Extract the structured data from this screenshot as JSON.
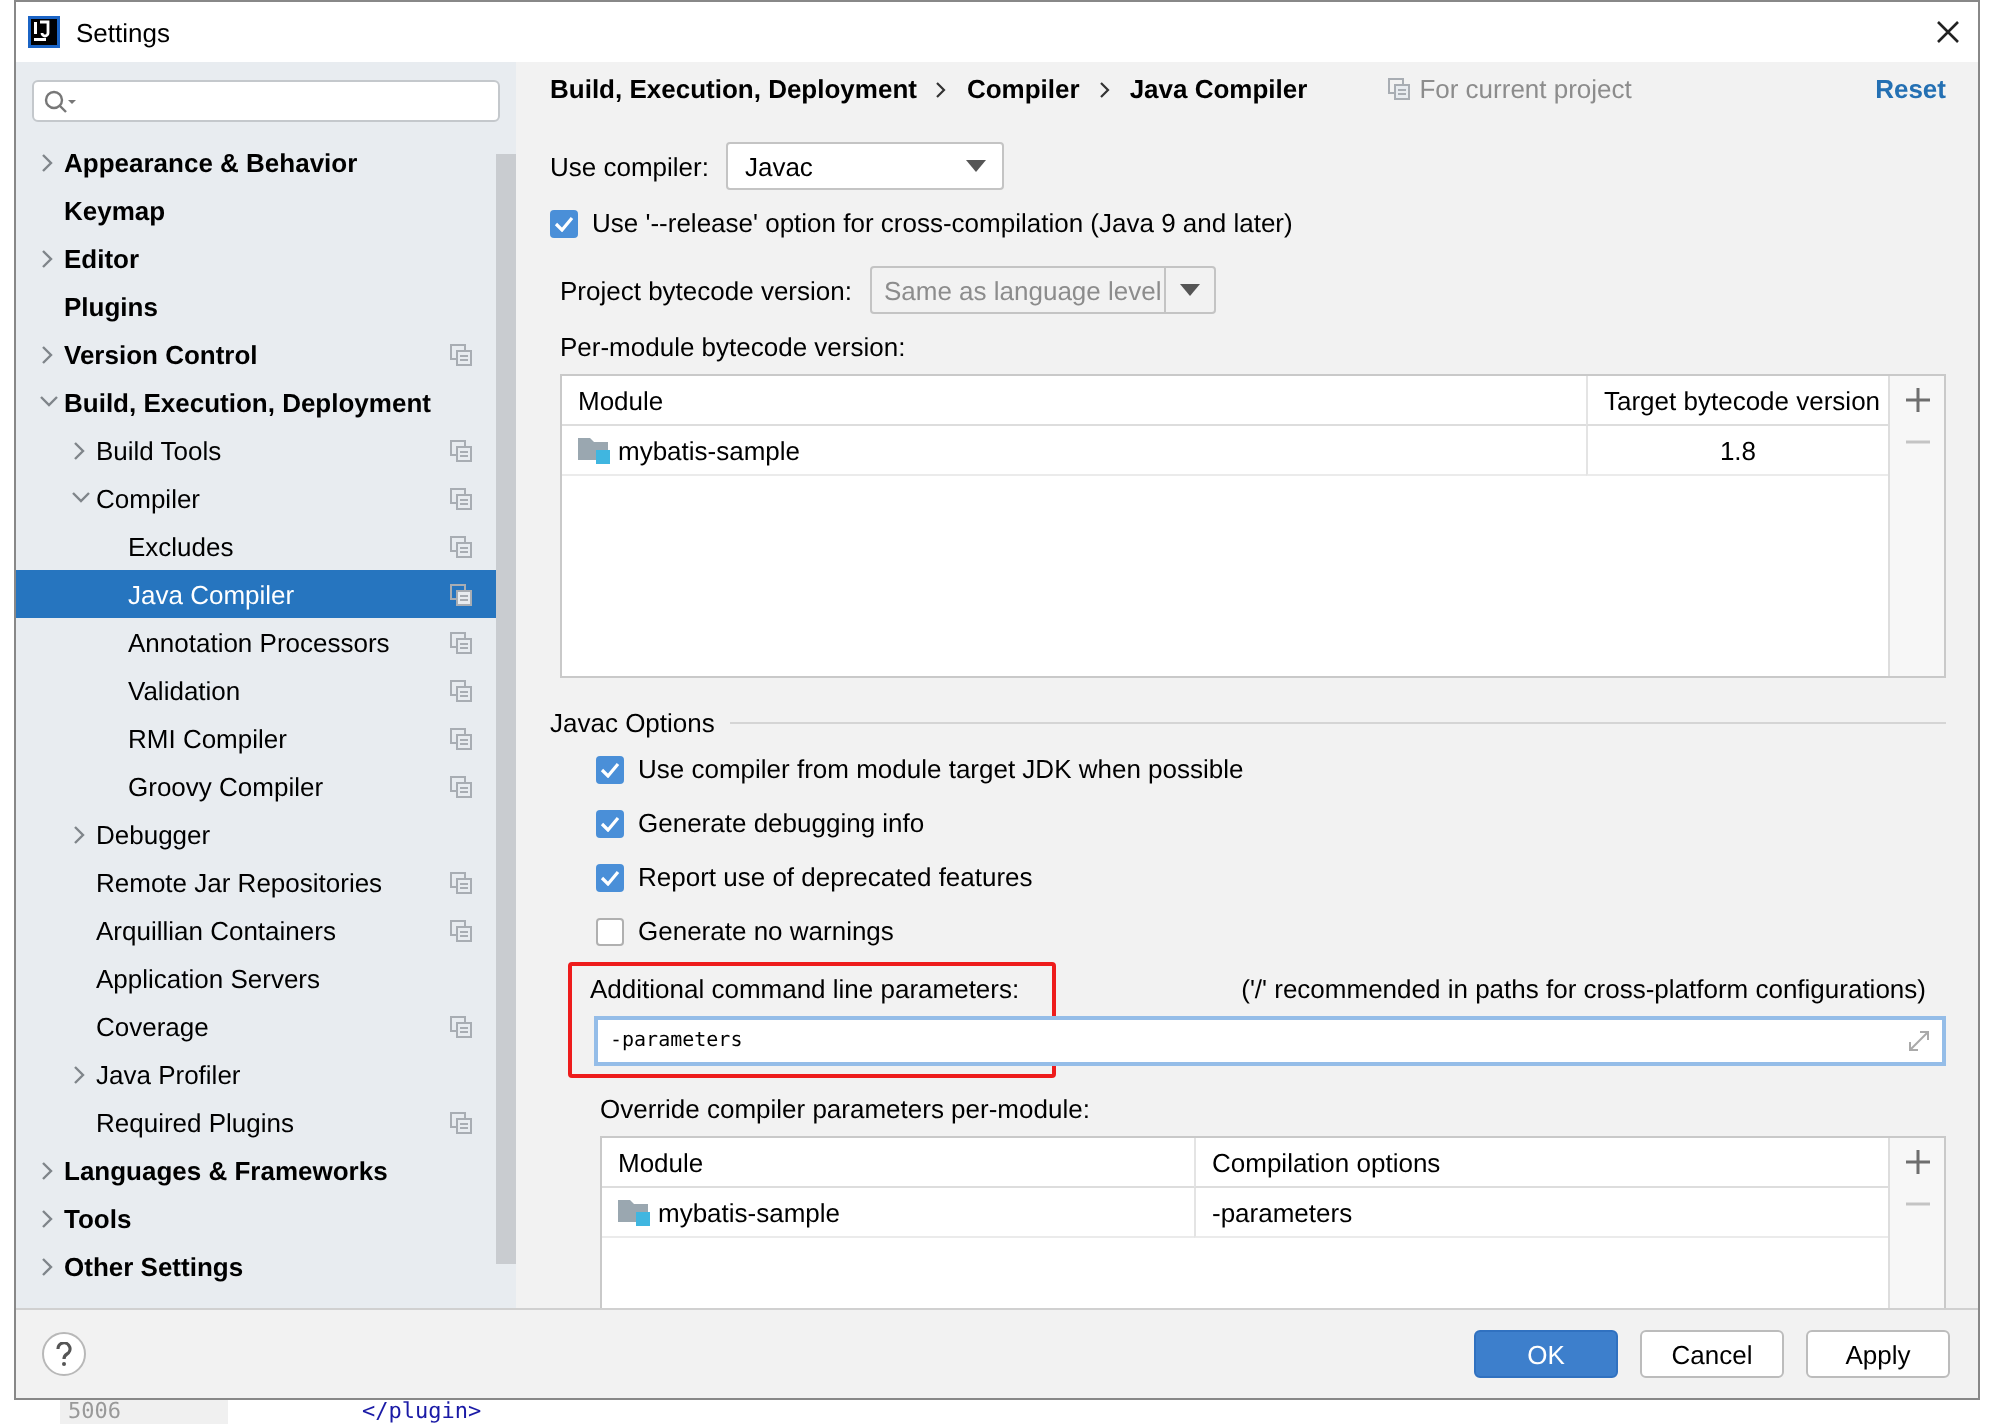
{
  "window": {
    "title": "Settings"
  },
  "sidebar": {
    "items": [
      {
        "label": "Appearance & Behavior",
        "expanded": false,
        "selected": false,
        "project_level": false
      },
      {
        "label": "Keymap",
        "selected": false,
        "project_level": false
      },
      {
        "label": "Editor",
        "expanded": false,
        "selected": false,
        "project_level": false
      },
      {
        "label": "Plugins",
        "selected": false,
        "project_level": false
      },
      {
        "label": "Version Control",
        "expanded": false,
        "selected": false,
        "project_level": true
      },
      {
        "label": "Build, Execution, Deployment",
        "expanded": true,
        "selected": false,
        "project_level": false,
        "children": [
          {
            "label": "Build Tools",
            "expanded": false,
            "selected": false,
            "project_level": true
          },
          {
            "label": "Compiler",
            "expanded": true,
            "selected": false,
            "project_level": true,
            "children": [
              {
                "label": "Excludes",
                "selected": false,
                "project_level": true
              },
              {
                "label": "Java Compiler",
                "selected": true,
                "project_level": true
              },
              {
                "label": "Annotation Processors",
                "selected": false,
                "project_level": true
              },
              {
                "label": "Validation",
                "selected": false,
                "project_level": true
              },
              {
                "label": "RMI Compiler",
                "selected": false,
                "project_level": true
              },
              {
                "label": "Groovy Compiler",
                "selected": false,
                "project_level": true
              }
            ]
          },
          {
            "label": "Debugger",
            "expanded": false,
            "selected": false,
            "project_level": false
          },
          {
            "label": "Remote Jar Repositories",
            "selected": false,
            "project_level": true
          },
          {
            "label": "Arquillian Containers",
            "selected": false,
            "project_level": true
          },
          {
            "label": "Application Servers",
            "selected": false,
            "project_level": false
          },
          {
            "label": "Coverage",
            "selected": false,
            "project_level": true
          },
          {
            "label": "Java Profiler",
            "expanded": false,
            "selected": false,
            "project_level": false
          },
          {
            "label": "Required Plugins",
            "selected": false,
            "project_level": true
          }
        ]
      },
      {
        "label": "Languages & Frameworks",
        "expanded": false,
        "selected": false,
        "project_level": false
      },
      {
        "label": "Tools",
        "expanded": false,
        "selected": false,
        "project_level": false
      },
      {
        "label": "Other Settings",
        "expanded": false,
        "selected": false,
        "project_level": false
      }
    ]
  },
  "breadcrumb": [
    "Build, Execution, Deployment",
    "Compiler",
    "Java Compiler"
  ],
  "scope_note": "For current project",
  "reset": "Reset",
  "use_compiler": {
    "label": "Use compiler:",
    "value": "Javac"
  },
  "release_option": {
    "label": "Use '--release' option for cross-compilation (Java 9 and later)",
    "checked": true
  },
  "project_bytecode": {
    "label": "Project bytecode version:",
    "value": "Same as language level",
    "disabled": true
  },
  "per_module": {
    "label": "Per-module bytecode version:",
    "columns": [
      "Module",
      "Target bytecode version"
    ],
    "rows": [
      [
        "mybatis-sample",
        "1.8"
      ]
    ]
  },
  "javac_options": {
    "title": "Javac Options",
    "checkboxes": [
      {
        "label": "Use compiler from module target JDK when possible",
        "checked": true
      },
      {
        "label": "Generate debugging info",
        "checked": true
      },
      {
        "label": "Report use of deprecated features",
        "checked": true
      },
      {
        "label": "Generate no warnings",
        "checked": false
      }
    ]
  },
  "additional_params": {
    "label": "Additional command line parameters:",
    "hint": "('/' recommended in paths for cross-platform configurations)",
    "value": "-parameters",
    "highlighted": true
  },
  "override": {
    "label": "Override compiler parameters per-module:",
    "columns": [
      "Module",
      "Compilation options"
    ],
    "rows": [
      [
        "mybatis-sample",
        "-parameters"
      ]
    ]
  },
  "buttons": [
    {
      "label": "OK",
      "kind": "primary"
    },
    {
      "label": "Cancel",
      "kind": "normal"
    },
    {
      "label": "Apply",
      "kind": "normal"
    }
  ],
  "background_editor": {
    "line_number": "5006",
    "code": "</plugin>"
  }
}
